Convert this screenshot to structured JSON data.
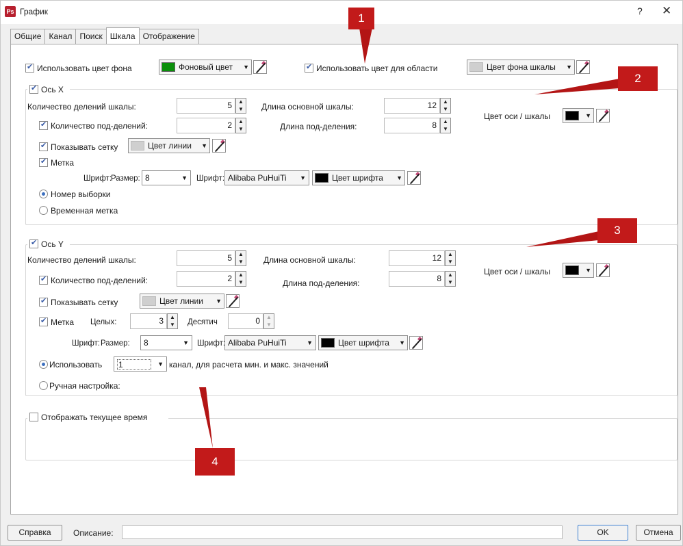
{
  "window": {
    "title": "График",
    "help": "?",
    "close": "✕",
    "app_icon": "Ps"
  },
  "tabs": [
    {
      "label": "Общие",
      "active": false
    },
    {
      "label": "Канал",
      "active": false
    },
    {
      "label": "Поиск",
      "active": false
    },
    {
      "label": "Шкала",
      "active": true
    },
    {
      "label": "Отображение",
      "active": false
    }
  ],
  "top": {
    "use_bg": {
      "label": "Использовать цвет фона",
      "checked": true
    },
    "bg_color": {
      "label": "Фоновый цвет",
      "color": "#0a8f0a"
    },
    "use_area": {
      "label": "Использовать цвет для области",
      "checked": true
    },
    "area_color": {
      "label": "Цвет фона шкалы",
      "color": "#cfcfcf"
    }
  },
  "axis_x": {
    "title": "Ось X",
    "checked": true,
    "divisions": {
      "label": "Количество делений шкалы:",
      "value": "5"
    },
    "main_len": {
      "label": "Длина основной шкалы:",
      "value": "12"
    },
    "subdiv": {
      "label": "Количество под-делений:",
      "value": "2",
      "checked": true
    },
    "sub_len": {
      "label": "Длина под-деления:",
      "value": "8"
    },
    "axis_color": {
      "label": "Цвет оси / шкалы",
      "color": "#000000"
    },
    "grid": {
      "label": "Показывать сетку",
      "checked": true,
      "color_label": "Цвет линии",
      "color": "#cfcfcf"
    },
    "mark": {
      "label": "Метка",
      "checked": true
    },
    "font_label": "Шрифт:",
    "size_label": "Размер:",
    "size_value": "8",
    "font2_label": "Шрифт:",
    "font_value": "Alibaba PuHuiTi",
    "font_color": {
      "label": "Цвет шрифта",
      "color": "#000000"
    },
    "radio_sample": {
      "label": "Номер выборки",
      "selected": true
    },
    "radio_time": {
      "label": "Временная метка",
      "selected": false
    }
  },
  "axis_y": {
    "title": "Ось Y",
    "checked": true,
    "divisions": {
      "label": "Количество делений шкалы:",
      "value": "5"
    },
    "main_len": {
      "label": "Длина основной шкалы:",
      "value": "12"
    },
    "subdiv": {
      "label": "Количество под-делений:",
      "value": "2",
      "checked": true
    },
    "sub_len": {
      "label": "Длина под-деления:",
      "value": "8"
    },
    "axis_color": {
      "label": "Цвет оси / шкалы",
      "color": "#000000"
    },
    "grid": {
      "label": "Показывать сетку",
      "checked": true,
      "color_label": "Цвет линии",
      "color": "#cfcfcf"
    },
    "mark": {
      "label": "Метка",
      "checked": true
    },
    "int_label": "Целых:",
    "int_value": "3",
    "dec_label": "Десятич",
    "dec_value": "0",
    "font_label": "Шрифт:",
    "size_label": "Размер:",
    "size_value": "8",
    "font2_label": "Шрифт:",
    "font_value": "Alibaba PuHuiTi",
    "font_color": {
      "label": "Цвет шрифта",
      "color": "#000000"
    },
    "radio_use": {
      "label": "Использовать",
      "selected": true
    },
    "channel_value": "1",
    "channel_suffix": "канал, для расчета мин. и макс. значений",
    "radio_manual": {
      "label": "Ручная настройка:",
      "selected": false
    }
  },
  "show_time": {
    "label": "Отображать текущее время",
    "checked": false
  },
  "callouts": [
    "1",
    "2",
    "3",
    "4"
  ],
  "bottom": {
    "help": "Справка",
    "desc_label": "Описание:",
    "desc_value": "",
    "ok": "OK",
    "cancel": "Отмена"
  },
  "colors": {
    "callout": "#c21a1a",
    "accent": "#3c6fbf"
  }
}
